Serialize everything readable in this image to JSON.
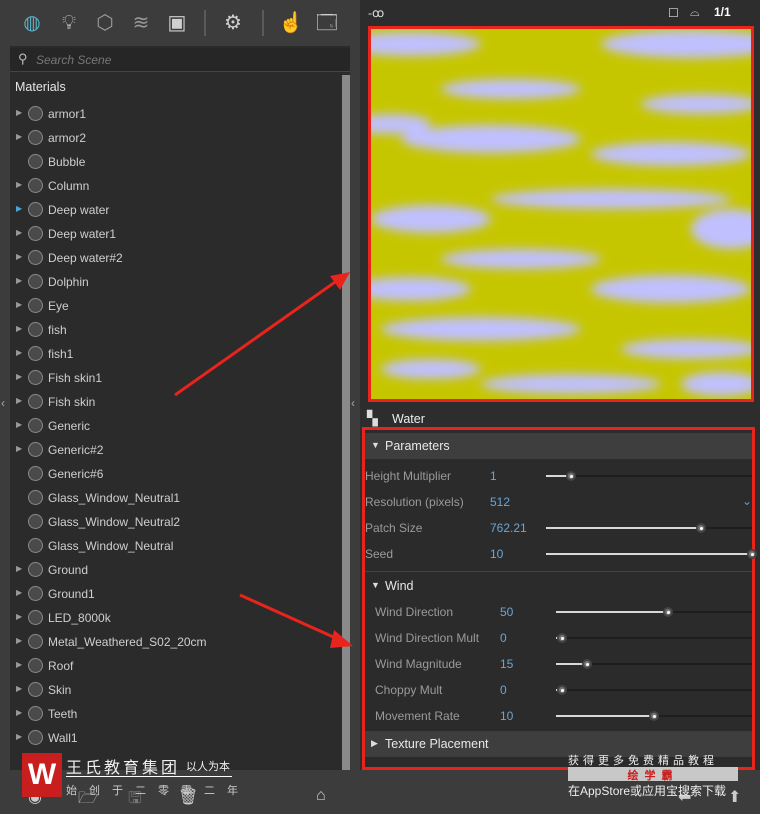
{
  "toolbar": {
    "icons": [
      "material-ball-icon",
      "light-bulb-icon",
      "cube-icon",
      "layers-icon",
      "texture-icon",
      "gear-icon",
      "teapot-hand-icon",
      "window-icon"
    ]
  },
  "search": {
    "placeholder": "Search Scene"
  },
  "materials": {
    "title": "Materials",
    "items": [
      {
        "label": "armor1",
        "arrow": true
      },
      {
        "label": "armor2",
        "arrow": true
      },
      {
        "label": "Bubble",
        "arrow": false
      },
      {
        "label": "Column",
        "arrow": true
      },
      {
        "label": "Deep water",
        "arrow": true,
        "active": true
      },
      {
        "label": "Deep water1",
        "arrow": true
      },
      {
        "label": "Deep water#2",
        "arrow": true
      },
      {
        "label": "Dolphin",
        "arrow": true
      },
      {
        "label": "Eye",
        "arrow": true
      },
      {
        "label": "fish",
        "arrow": true
      },
      {
        "label": "fish1",
        "arrow": true
      },
      {
        "label": "Fish skin1",
        "arrow": true
      },
      {
        "label": "Fish skin",
        "arrow": true
      },
      {
        "label": "Generic",
        "arrow": true
      },
      {
        "label": "Generic#2",
        "arrow": true
      },
      {
        "label": "Generic#6",
        "arrow": false
      },
      {
        "label": "Glass_Window_Neutral1",
        "arrow": false
      },
      {
        "label": "Glass_Window_Neutral2",
        "arrow": false
      },
      {
        "label": "Glass_Window_Neutral",
        "arrow": false
      },
      {
        "label": "Ground",
        "arrow": true
      },
      {
        "label": "Ground1",
        "arrow": true
      },
      {
        "label": "LED_8000k",
        "arrow": true
      },
      {
        "label": "Metal_Weathered_S02_20cm",
        "arrow": true
      },
      {
        "label": "Roof",
        "arrow": true
      },
      {
        "label": "Skin",
        "arrow": true
      },
      {
        "label": "Teeth",
        "arrow": true
      },
      {
        "label": "Wall1",
        "arrow": true
      }
    ]
  },
  "preview": {
    "ratio_label": "1/1",
    "colors": {
      "base": "#c6c600",
      "streak": "#c0c0ff",
      "highlight": "#e8241c"
    }
  },
  "texture": {
    "name": "Water"
  },
  "parameters": {
    "title": "Parameters",
    "rows": [
      {
        "label": "Height Multiplier",
        "value": "1",
        "fraction": 0.12
      },
      {
        "label": "Resolution (pixels)",
        "value": "512",
        "dropdown": true
      },
      {
        "label": "Patch Size",
        "value": "762.21",
        "fraction": 0.75
      },
      {
        "label": "Seed",
        "value": "10",
        "fraction": 1.0
      }
    ]
  },
  "wind": {
    "title": "Wind",
    "rows": [
      {
        "label": "Wind Direction",
        "value": "50",
        "fraction": 0.57
      },
      {
        "label": "Wind Direction Mult",
        "value": "0",
        "fraction": 0.03
      },
      {
        "label": "Wind Magnitude",
        "value": "15",
        "fraction": 0.16
      },
      {
        "label": "Choppy Mult",
        "value": "0",
        "fraction": 0.03
      },
      {
        "label": "Movement Rate",
        "value": "10",
        "fraction": 0.5
      }
    ]
  },
  "texture_placement": {
    "title": "Texture Placement"
  },
  "watermark": {
    "brand": "王氏教育集团",
    "slogan": "以人为本",
    "founded": "始创于二零零二年",
    "promo": "获得更多免费精品教程",
    "app": "绘学霸",
    "download": "在AppStore或应用宝搜索下载"
  }
}
